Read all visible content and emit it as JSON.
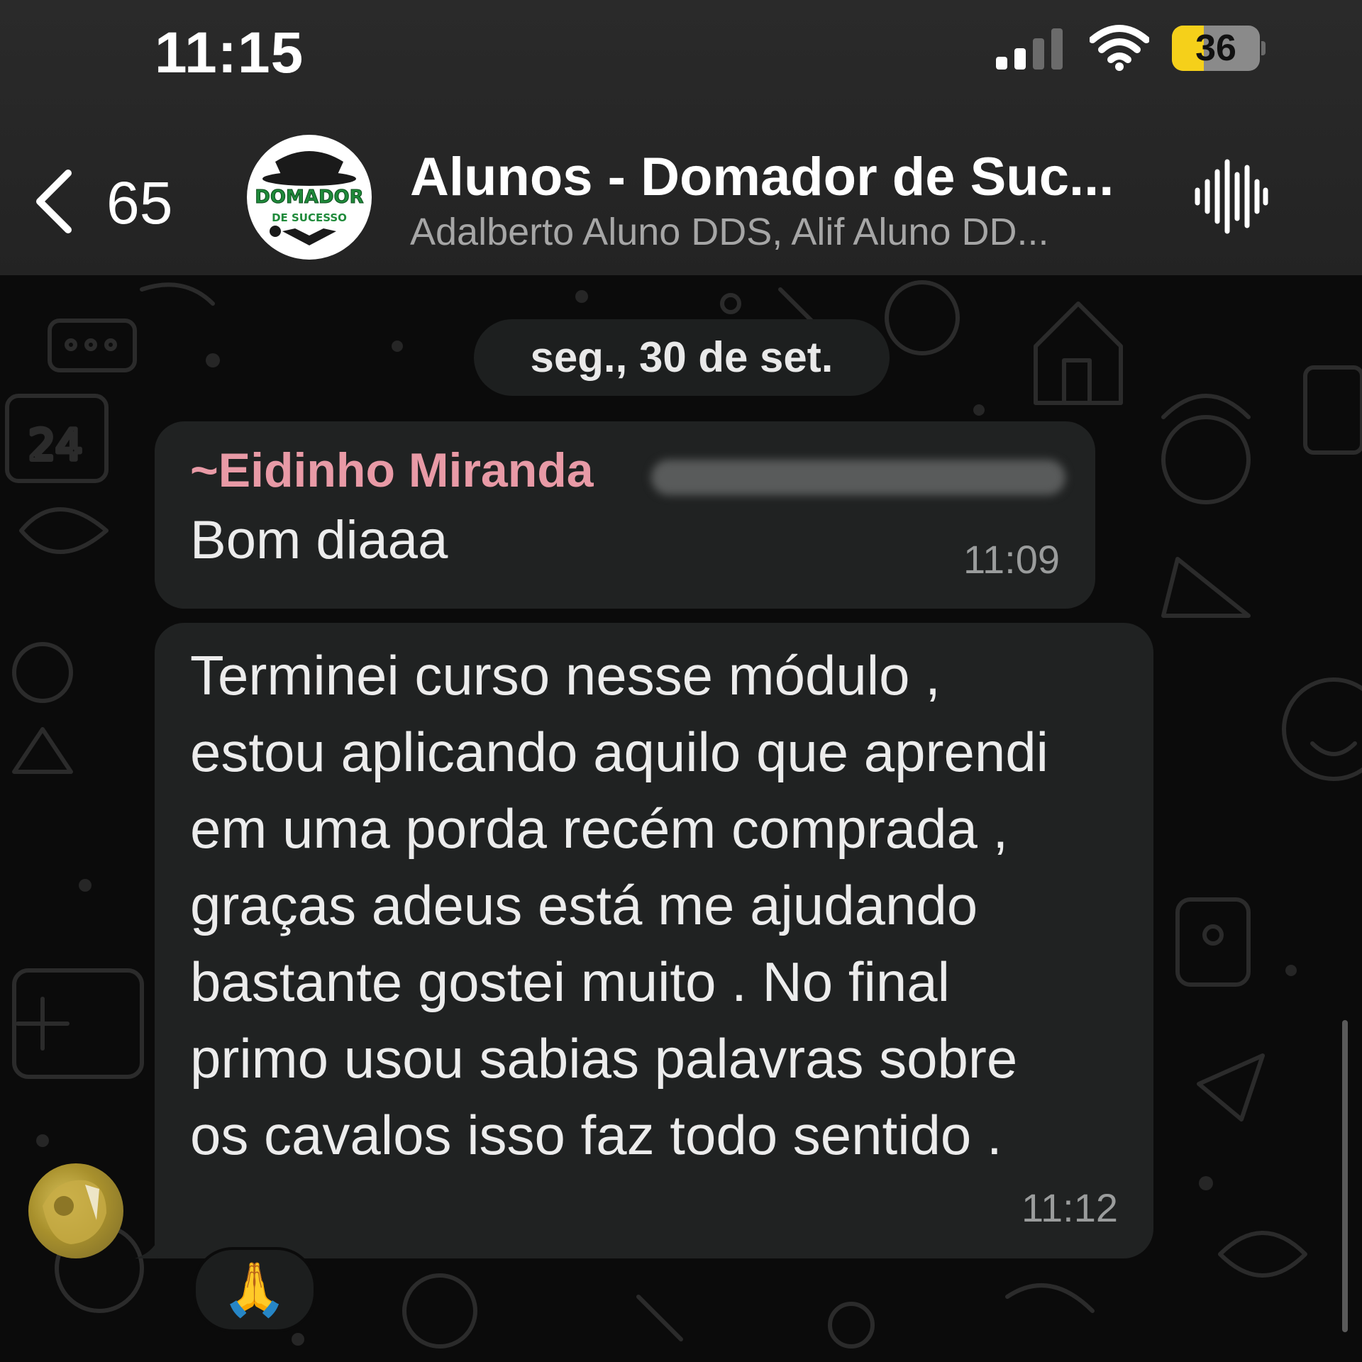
{
  "status_bar": {
    "time": "11:15",
    "battery_level": "36",
    "battery_fraction": 0.36,
    "signal_icon": "cellular-signal-icon",
    "wifi_icon": "wifi-icon"
  },
  "header": {
    "unread_count": "65",
    "back_icon": "chevron-left-icon",
    "group_title": "Alunos - Domador de Suc...",
    "group_members": "Adalberto Aluno DDS, Alif Aluno DD...",
    "avatar_logo_line1": "DOMADOR",
    "avatar_logo_line2": "DE SUCESSO",
    "call_icon": "audio-waveform-icon"
  },
  "chat": {
    "date_chip": "seg., 30 de set.",
    "messages": [
      {
        "sender_prefix": "~",
        "sender_name": "Eidinho Miranda",
        "text": "Bom diaaa",
        "time": "11:09"
      },
      {
        "text": "Terminei curso nesse módulo ,\nestou aplicando aquilo que aprendi\nem uma porda recém comprada ,\ngraças adeus está me ajudando\nbastante gostei muito . No final\nprimo usou sabias palavras sobre\nos cavalos isso faz todo sentido .",
        "time": "11:12",
        "reaction": "🙏"
      }
    ]
  },
  "colors": {
    "background": "#0b0b0b",
    "header": "#262626",
    "bubble": "#202222",
    "sender_name": "#e89aa6",
    "battery": "#f5d01a",
    "timestamp": "#9a9c9c"
  }
}
